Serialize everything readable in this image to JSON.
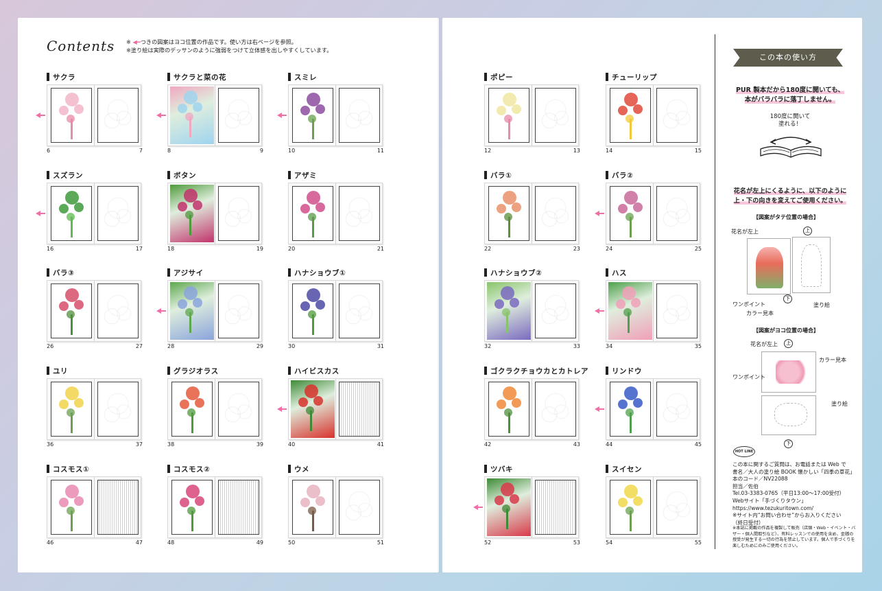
{
  "left_page": {
    "title": "Contents",
    "notes": [
      "※ ",
      "つきの図案はヨコ位置の作品です。使い方は右ページを参照。",
      "※塗り絵は実際のデッサンのように強弱をつけて立体感を出しやすくしています。"
    ]
  },
  "items": [
    {
      "title": "サクラ",
      "left": "6",
      "right": "7",
      "arrow": true,
      "hue": "#f2b6c8",
      "accent": "#e98aa8"
    },
    {
      "title": "サクラと菜の花",
      "left": "8",
      "right": "9",
      "arrow": true,
      "hue": "#9fd4ef",
      "accent": "#f0a7c0"
    },
    {
      "title": "スミレ",
      "left": "10",
      "right": "11",
      "arrow": true,
      "hue": "#8c4ea0",
      "accent": "#6aa04f"
    },
    {
      "title": "スズラン",
      "left": "16",
      "right": "17",
      "arrow": true,
      "hue": "#3f9a3c",
      "accent": "#5fbb4f"
    },
    {
      "title": "ボタン",
      "left": "18",
      "right": "19",
      "arrow": false,
      "hue": "#c2336c",
      "accent": "#4f9a3c"
    },
    {
      "title": "アザミ",
      "left": "20",
      "right": "21",
      "arrow": false,
      "hue": "#d04f8c",
      "accent": "#5a9a49"
    },
    {
      "title": "バラ③",
      "left": "26",
      "right": "27",
      "arrow": false,
      "hue": "#d64f6a",
      "accent": "#4f8f3c"
    },
    {
      "title": "アジサイ",
      "left": "28",
      "right": "29",
      "arrow": true,
      "hue": "#8aa4dc",
      "accent": "#5fa84f"
    },
    {
      "title": "ハナショウブ①",
      "left": "30",
      "right": "31",
      "arrow": false,
      "hue": "#4e4aa6",
      "accent": "#4f9a3c"
    },
    {
      "title": "ユリ",
      "left": "36",
      "right": "37",
      "arrow": false,
      "hue": "#f1d24a",
      "accent": "#6aa04f"
    },
    {
      "title": "グラジオラス",
      "left": "38",
      "right": "39",
      "arrow": false,
      "hue": "#e45a3c",
      "accent": "#4f9a3c"
    },
    {
      "title": "ハイビスカス",
      "left": "40",
      "right": "41",
      "arrow": true,
      "hue": "#d8322c",
      "accent": "#3e8a36"
    },
    {
      "title": "コスモス①",
      "left": "46",
      "right": "47",
      "arrow": false,
      "hue": "#e98ab0",
      "accent": "#6aa04f"
    },
    {
      "title": "コスモス②",
      "left": "48",
      "right": "49",
      "arrow": false,
      "hue": "#d8467a",
      "accent": "#4f9a3c"
    },
    {
      "title": "ウメ",
      "left": "50",
      "right": "51",
      "arrow": false,
      "hue": "#e8b4c0",
      "accent": "#7a5a46"
    },
    {
      "title": "ポピー",
      "left": "12",
      "right": "13",
      "arrow": false,
      "hue": "#f0e6a0",
      "accent": "#e88aa8"
    },
    {
      "title": "チューリップ",
      "left": "14",
      "right": "15",
      "arrow": false,
      "hue": "#e24a3c",
      "accent": "#f1c93a"
    },
    {
      "title": "バラ①",
      "left": "22",
      "right": "23",
      "arrow": false,
      "hue": "#e9906a",
      "accent": "#5a8f3c"
    },
    {
      "title": "バラ②",
      "left": "24",
      "right": "25",
      "arrow": true,
      "hue": "#c86a9a",
      "accent": "#6aa04f"
    },
    {
      "title": "ハナショウブ②",
      "left": "32",
      "right": "33",
      "arrow": false,
      "hue": "#7a6ac0",
      "accent": "#88c46a"
    },
    {
      "title": "ハス",
      "left": "34",
      "right": "35",
      "arrow": true,
      "hue": "#f0a0b8",
      "accent": "#4fa04c"
    },
    {
      "title": "ゴクラクチョウカとカトレア",
      "left": "42",
      "right": "43",
      "arrow": false,
      "hue": "#f08a3a",
      "accent": "#4f8f3c"
    },
    {
      "title": "リンドウ",
      "left": "44",
      "right": "45",
      "arrow": true,
      "hue": "#3a5ac8",
      "accent": "#4fa04c"
    },
    {
      "title": "ツバキ",
      "left": "52",
      "right": "53",
      "arrow": true,
      "hue": "#d83a4a",
      "accent": "#3e8a36"
    },
    {
      "title": "スイセン",
      "left": "54",
      "right": "55",
      "arrow": false,
      "hue": "#f1d84a",
      "accent": "#6aa04f"
    }
  ],
  "sidebar": {
    "header": "この本の使い方",
    "p1_line1": "PUR 製本だから180度に開いても、",
    "p1_line2": "本がバラバラに落丁しません。",
    "p2_line1": "180度に開いて",
    "p2_line2": "塗れる！",
    "p3_line1": "花名が左上にくるように、以下のように",
    "p3_line2": "上・下の向きを変えてご使用ください。",
    "tate_heading": "【図案がタテ位置の場合】",
    "yoko_heading": "【図案がヨコ位置の場合】",
    "label_flower_name": "花名が左上",
    "label_onepoint": "ワンポイント",
    "label_color_sample": "カラー見本",
    "label_nurie": "塗り絵",
    "label_top": "上",
    "label_bottom": "下",
    "hotline": "HOT LINE",
    "contact": [
      "この本に関するご質問は、お電話または Web で",
      "書名／大人の塗り絵 BOOK 懐かしい「四季の草花」",
      "本のコード／NV22088",
      "担当／佐伯",
      "Tel.03-3383-0765（平日13:00～17:00受付）",
      "Webサイト「手づくりタウン」",
      "https://www.tezukuritown.com/",
      "※サイト内“お問い合わせ”からお入りください",
      "（終日受付）"
    ],
    "footnote": "※本誌に掲載の作品を複製して販売（店頭・Web・イベント・バザー・個人間取引など）、有料レッスンでの使用を含め、金銭の授受が発生する一切の行為を禁止しています。個人で手づくりを楽しむためにのみご使用ください。"
  },
  "colors": {
    "pink_arrow": "#ef6fa6",
    "header_bg": "#5e5c4d",
    "highlight": "#f7c6da"
  }
}
